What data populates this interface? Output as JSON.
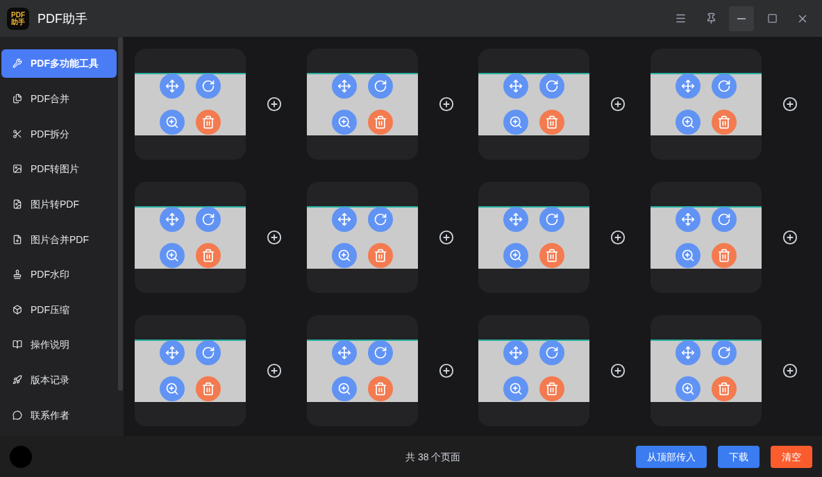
{
  "app": {
    "logo_top": "PDF",
    "logo_bottom": "助手",
    "title": "PDF助手"
  },
  "sidebar": {
    "items": [
      {
        "label": "PDF多功能工具",
        "selected": true
      },
      {
        "label": "PDF合并",
        "selected": false
      },
      {
        "label": "PDF拆分",
        "selected": false
      },
      {
        "label": "PDF转图片",
        "selected": false
      },
      {
        "label": "图片转PDF",
        "selected": false
      },
      {
        "label": "图片合并PDF",
        "selected": false
      },
      {
        "label": "PDF水印",
        "selected": false
      },
      {
        "label": "PDF压缩",
        "selected": false
      },
      {
        "label": "操作说明",
        "selected": false
      },
      {
        "label": "版本记录",
        "selected": false
      },
      {
        "label": "联系作者",
        "selected": false
      }
    ]
  },
  "pages": [
    {
      "kind": "slide"
    },
    {
      "kind": "slide"
    },
    {
      "kind": "slide"
    },
    {
      "kind": "slide"
    },
    {
      "kind": "slide"
    },
    {
      "kind": "slide"
    },
    {
      "kind": "slide"
    },
    {
      "kind": "slide"
    },
    {
      "kind": "slide"
    },
    {
      "kind": "slide"
    },
    {
      "kind": "slide"
    },
    {
      "kind": "slide"
    }
  ],
  "footer": {
    "page_count": "共 38 个页面",
    "buttons": [
      {
        "label": "从顶部传入",
        "kind": "primary"
      },
      {
        "label": "下载",
        "kind": "primary"
      },
      {
        "label": "清空",
        "kind": "danger"
      }
    ]
  }
}
